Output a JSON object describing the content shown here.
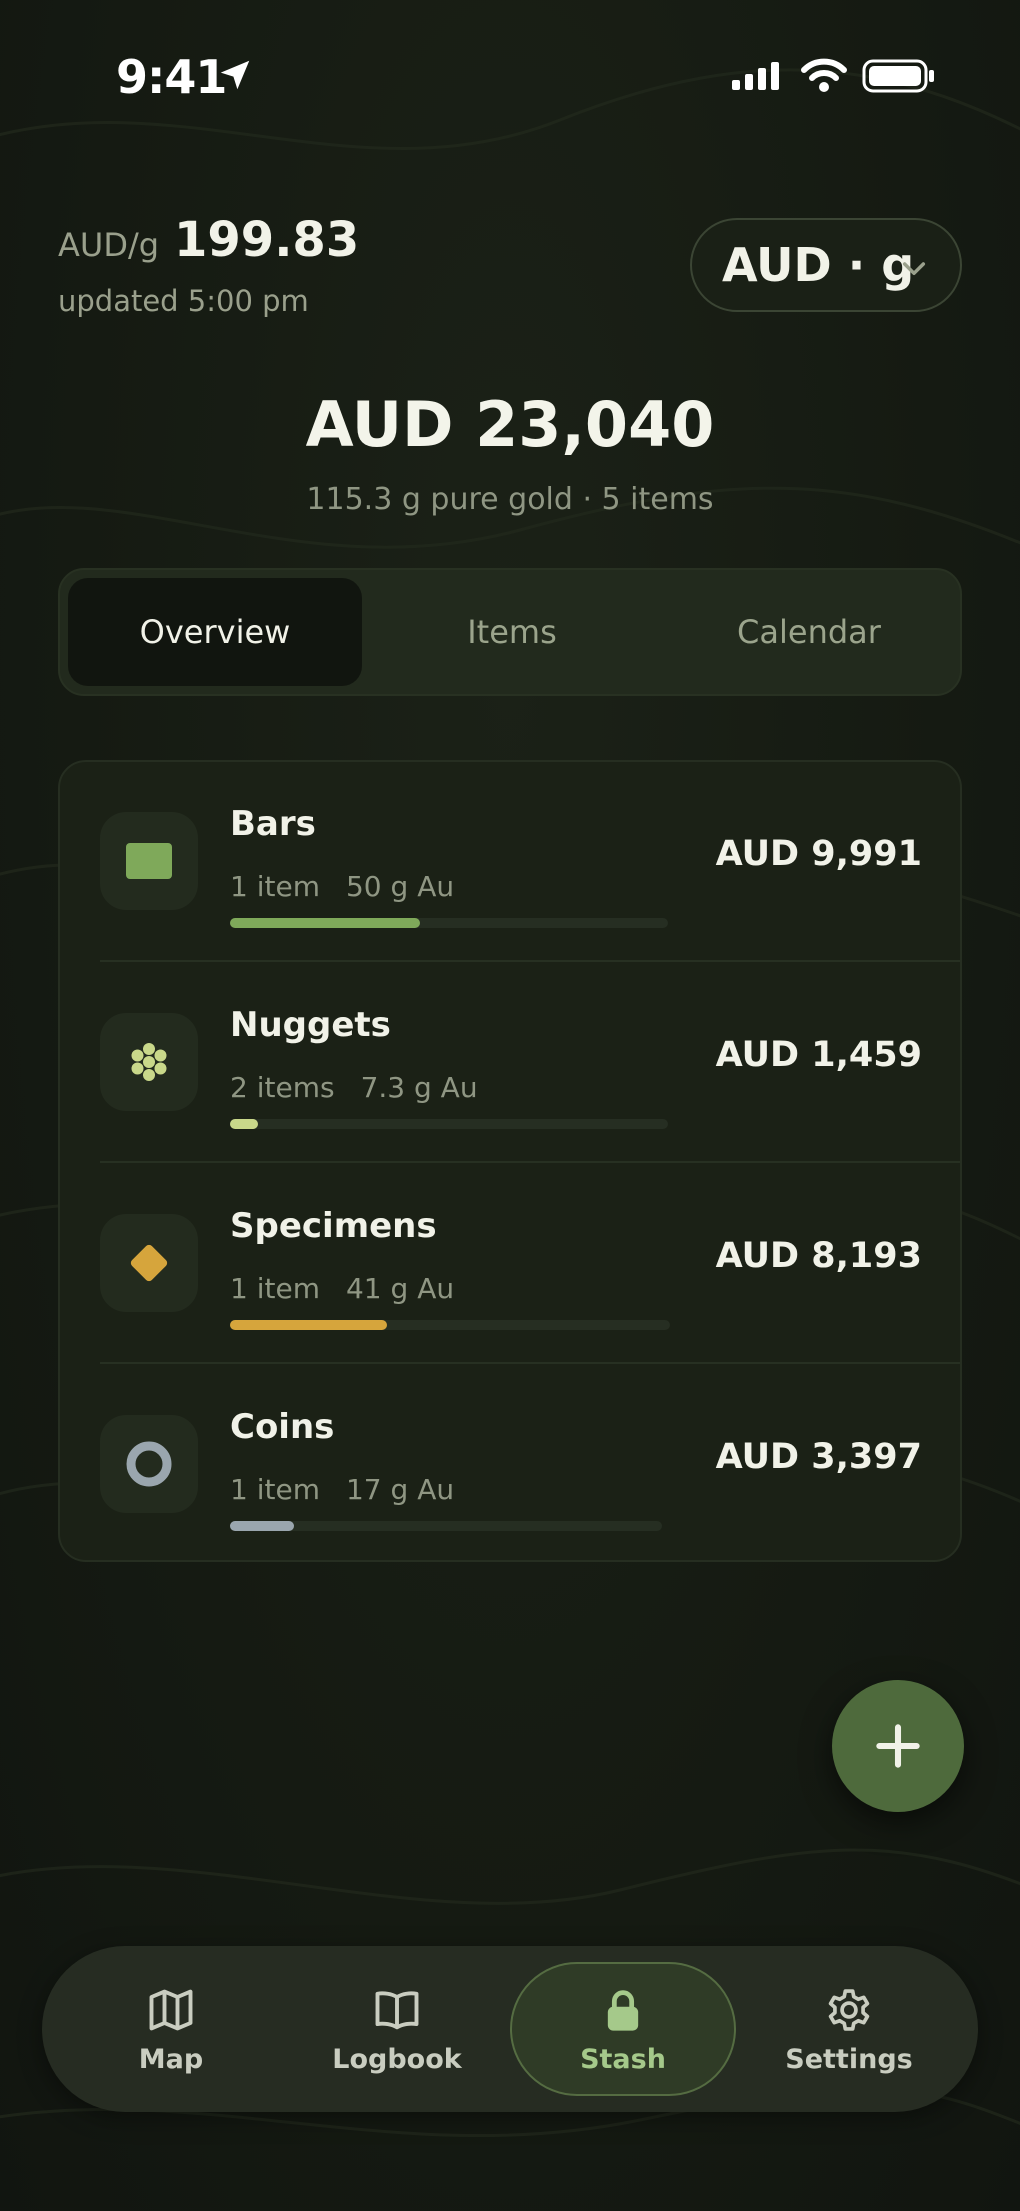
{
  "status_bar": {
    "time": "9:41"
  },
  "price": {
    "unit_label": "AUD/g",
    "value": "199.83",
    "updated": "updated 5:00 pm"
  },
  "unit_selector": {
    "label": "AUD · g"
  },
  "summary": {
    "total": "AUD 23,040",
    "subtitle": "115.3 g pure gold · 5 items"
  },
  "tabs": [
    {
      "label": "Overview",
      "active": true
    },
    {
      "label": "Items",
      "active": false
    },
    {
      "label": "Calendar",
      "active": false
    }
  ],
  "categories": [
    {
      "name": "Bars",
      "count": "1 item",
      "weight": "50 g Au",
      "value": "AUD 9,991",
      "share": 0.434,
      "color": "#7fa95a",
      "icon": "bar-icon"
    },
    {
      "name": "Nuggets",
      "count": "2 items",
      "weight": "7.3 g Au",
      "value": "AUD 1,459",
      "share": 0.063,
      "color": "#c9d88a",
      "icon": "nugget-icon"
    },
    {
      "name": "Specimens",
      "count": "1 item",
      "weight": "41 g Au",
      "value": "AUD 8,193",
      "share": 0.356,
      "color": "#d6a53c",
      "icon": "specimen-icon"
    },
    {
      "name": "Coins",
      "count": "1 item",
      "weight": "17 g Au",
      "value": "AUD 3,397",
      "share": 0.147,
      "color": "#9aa6ae",
      "icon": "coin-icon"
    }
  ],
  "fab": {
    "icon": "plus-icon"
  },
  "nav": [
    {
      "label": "Map",
      "icon": "map-icon",
      "active": false
    },
    {
      "label": "Logbook",
      "icon": "book-icon",
      "active": false
    },
    {
      "label": "Stash",
      "icon": "lock-icon",
      "active": true
    },
    {
      "label": "Settings",
      "icon": "gear-icon",
      "active": false
    }
  ],
  "colors": {
    "accent": "#a5c98a",
    "fab": "#4e6a3c",
    "background": "#151a12"
  }
}
